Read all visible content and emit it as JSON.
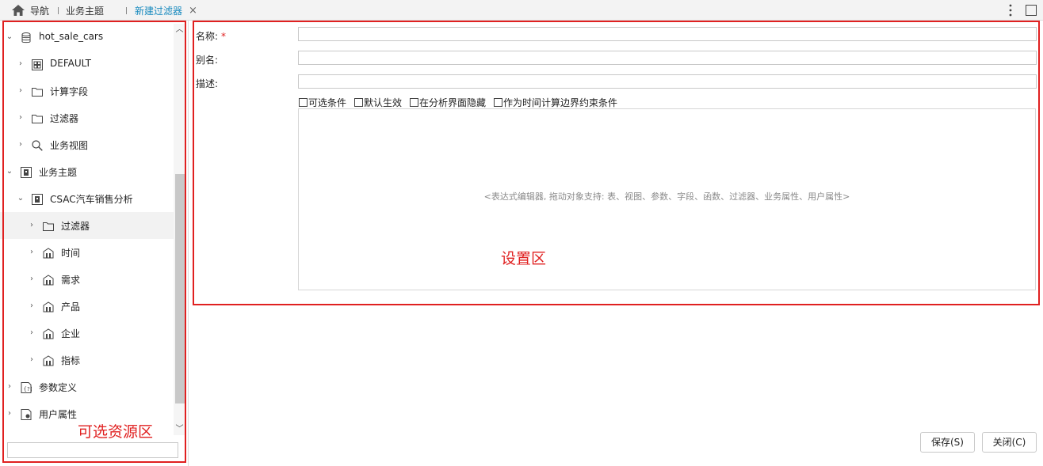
{
  "topbar": {
    "tabs": [
      {
        "label": "导航",
        "icon": "home-icon"
      },
      {
        "label": "业务主题"
      },
      {
        "label": "新建过滤器",
        "active": true
      }
    ],
    "accent_color": "#1a8bbf"
  },
  "tree": {
    "items": [
      {
        "label": "hot_sale_cars",
        "icon": "database-icon",
        "caret": "expanded"
      },
      {
        "label": "DEFAULT",
        "icon": "schema-icon",
        "caret": "collapsed"
      },
      {
        "label": "计算字段",
        "icon": "folder-icon",
        "caret": "collapsed"
      },
      {
        "label": "过滤器",
        "icon": "folder-icon",
        "caret": "collapsed"
      },
      {
        "label": "业务视图",
        "icon": "search-icon",
        "caret": "collapsed"
      },
      {
        "label": "业务主题",
        "icon": "business-theme-icon",
        "caret": "expanded"
      },
      {
        "label": "CSAC汽车销售分析",
        "icon": "business-theme-icon",
        "caret": "expanded"
      },
      {
        "label": "过滤器",
        "icon": "folder-icon",
        "caret": "collapsed",
        "selected": true
      },
      {
        "label": "时间",
        "icon": "dimension-icon",
        "caret": "collapsed"
      },
      {
        "label": "需求",
        "icon": "dimension-icon",
        "caret": "collapsed"
      },
      {
        "label": "产品",
        "icon": "dimension-icon",
        "caret": "collapsed"
      },
      {
        "label": "企业",
        "icon": "dimension-icon",
        "caret": "collapsed"
      },
      {
        "label": "指标",
        "icon": "dimension-icon",
        "caret": "collapsed"
      },
      {
        "label": "参数定义",
        "icon": "parameter-icon",
        "caret": "collapsed"
      },
      {
        "label": "用户属性",
        "icon": "user-attribute-icon",
        "caret": "collapsed"
      }
    ],
    "search_value": ""
  },
  "annotations": {
    "left_region": "可选资源区",
    "right_region": "设置区",
    "color": "#e02020"
  },
  "form": {
    "name_label": "名称:",
    "required_mark": "*",
    "alias_label": "别名:",
    "desc_label": "描述:",
    "name_value": "",
    "alias_value": "",
    "desc_value": "",
    "checkboxes": [
      {
        "label": "可选条件",
        "checked": false
      },
      {
        "label": "默认生效",
        "checked": false
      },
      {
        "label": "在分析界面隐藏",
        "checked": false
      },
      {
        "label": "作为时间计算边界约束条件",
        "checked": false
      }
    ],
    "editor_hint": "<表达式编辑器, 拖动对象支持: 表、视图、参数、字段、函数、过滤器、业务属性、用户属性>"
  },
  "buttons": {
    "save": "保存(S)",
    "close": "关闭(C)"
  }
}
